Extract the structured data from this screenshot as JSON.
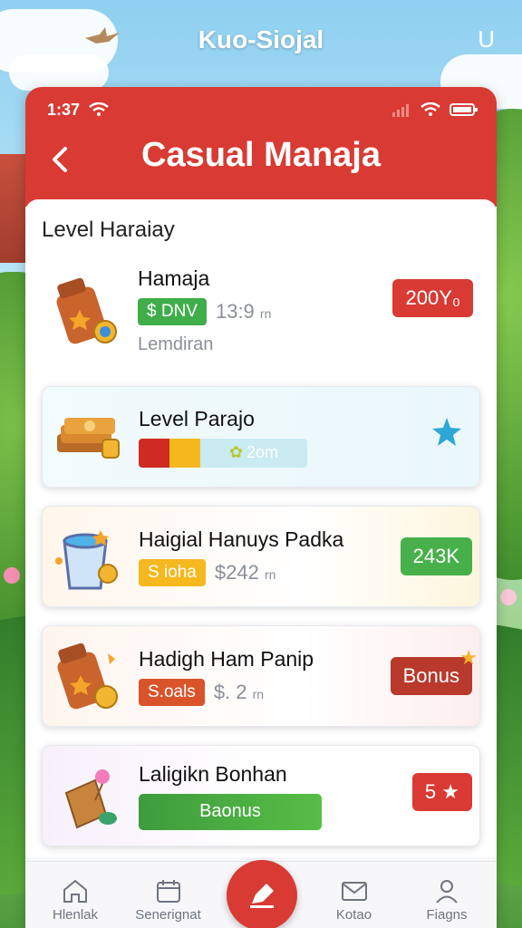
{
  "app_title": "Kuo-Siojal",
  "corner_glyph": "U",
  "status_bar": {
    "time": "1:37"
  },
  "header": {
    "title": "Casual Manaja"
  },
  "section": {
    "title": "Level Haraiay"
  },
  "cards": [
    {
      "name": "Hamaja",
      "tag": "$ DNV",
      "meta": "13:9",
      "meta_unit": "rn",
      "sub": "Lemdiran",
      "action": "200Y₀"
    },
    {
      "name": "Level Parajo",
      "progress_label": "2om"
    },
    {
      "name": "Haigial Hanuys Padka",
      "tag": "S ioha",
      "meta": "$242",
      "meta_unit": "rn",
      "action": "243K"
    },
    {
      "name": "Hadigh Ham Panip",
      "tag": "S.oals",
      "meta": "$. 2",
      "meta_unit": "rn",
      "action": "Bonus"
    },
    {
      "name": "Laligikn Bonhan",
      "bar_label": "Baonus",
      "action": "5 ★"
    }
  ],
  "nav": [
    {
      "label": "Hlenlak",
      "icon": "home-icon"
    },
    {
      "label": "Senerignat",
      "icon": "calendar-icon"
    },
    {
      "label": "",
      "icon": "edit-icon"
    },
    {
      "label": "Kotao",
      "icon": "mail-icon"
    },
    {
      "label": "Fiagns",
      "icon": "user-icon"
    }
  ],
  "colors": {
    "primary": "#d93a33",
    "green": "#3fae4a",
    "yellow": "#f6b81f"
  }
}
